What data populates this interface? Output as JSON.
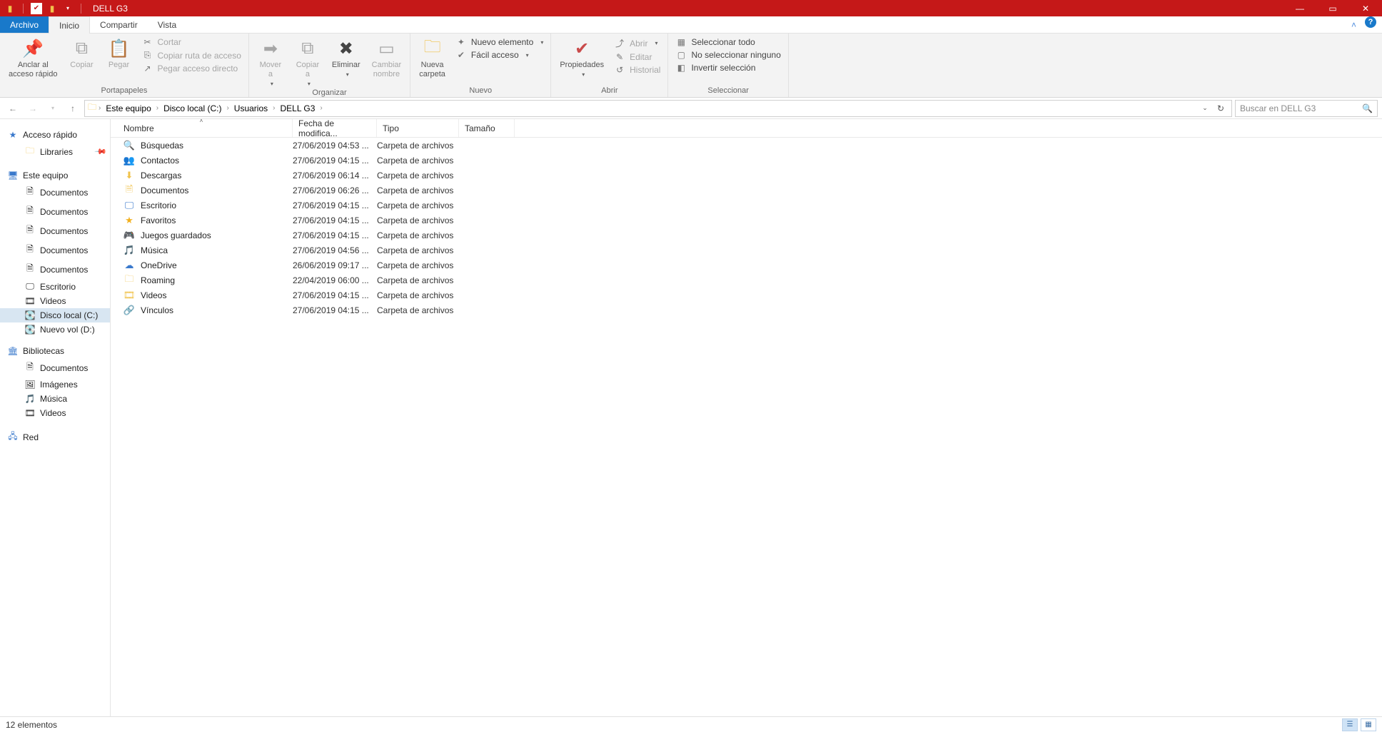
{
  "window": {
    "title": "DELL G3"
  },
  "menu": {
    "file": "Archivo",
    "tabs": [
      "Inicio",
      "Compartir",
      "Vista"
    ],
    "active_index": 0
  },
  "ribbon": {
    "groups": {
      "clipboard": {
        "label": "Portapapeles",
        "pin": "Anclar al\nacceso rápido",
        "copy": "Copiar",
        "paste": "Pegar",
        "cut": "Cortar",
        "copy_path": "Copiar ruta de acceso",
        "paste_shortcut": "Pegar acceso directo"
      },
      "organize": {
        "label": "Organizar",
        "move": "Mover\na",
        "copy_to": "Copiar\na",
        "delete": "Eliminar",
        "rename": "Cambiar\nnombre"
      },
      "new": {
        "label": "Nuevo",
        "new_folder": "Nueva\ncarpeta",
        "new_item": "Nuevo elemento",
        "easy_access": "Fácil acceso"
      },
      "open": {
        "label": "Abrir",
        "properties": "Propiedades",
        "open": "Abrir",
        "edit": "Editar",
        "history": "Historial"
      },
      "select": {
        "label": "Seleccionar",
        "select_all": "Seleccionar todo",
        "select_none": "No seleccionar ninguno",
        "invert": "Invertir selección"
      }
    }
  },
  "breadcrumb": [
    "Este equipo",
    "Disco local (C:)",
    "Usuarios",
    "DELL G3"
  ],
  "search": {
    "placeholder": "Buscar en DELL G3"
  },
  "tree": {
    "quick_access": "Acceso rápido",
    "libraries": "Libraries",
    "this_pc": "Este equipo",
    "this_pc_children": [
      "Documentos",
      "Documentos",
      "Documentos",
      "Documentos",
      "Documentos",
      "Escritorio",
      "Videos",
      "Disco local (C:)",
      "Nuevo vol (D:)"
    ],
    "libraries_root": "Bibliotecas",
    "libraries_children": [
      "Documentos",
      "Imágenes",
      "Música",
      "Videos"
    ],
    "network": "Red"
  },
  "columns": {
    "name": "Nombre",
    "date": "Fecha de modifica...",
    "type": "Tipo",
    "size": "Tamaño"
  },
  "rows": [
    {
      "icon": "search",
      "name": "Búsquedas",
      "date": "27/06/2019 04:53 ...",
      "type": "Carpeta de archivos"
    },
    {
      "icon": "contacts",
      "name": "Contactos",
      "date": "27/06/2019 04:15 ...",
      "type": "Carpeta de archivos"
    },
    {
      "icon": "downloads",
      "name": "Descargas",
      "date": "27/06/2019 06:14 ...",
      "type": "Carpeta de archivos"
    },
    {
      "icon": "docs",
      "name": "Documentos",
      "date": "27/06/2019 06:26 ...",
      "type": "Carpeta de archivos"
    },
    {
      "icon": "desktop",
      "name": "Escritorio",
      "date": "27/06/2019 04:15 ...",
      "type": "Carpeta de archivos"
    },
    {
      "icon": "fav",
      "name": "Favoritos",
      "date": "27/06/2019 04:15 ...",
      "type": "Carpeta de archivos"
    },
    {
      "icon": "games",
      "name": "Juegos guardados",
      "date": "27/06/2019 04:15 ...",
      "type": "Carpeta de archivos"
    },
    {
      "icon": "music",
      "name": "Música",
      "date": "27/06/2019 04:56 ...",
      "type": "Carpeta de archivos"
    },
    {
      "icon": "onedrive",
      "name": "OneDrive",
      "date": "26/06/2019 09:17 ...",
      "type": "Carpeta de archivos"
    },
    {
      "icon": "folder",
      "name": "Roaming",
      "date": "22/04/2019 06:00 ...",
      "type": "Carpeta de archivos"
    },
    {
      "icon": "videos",
      "name": "Videos",
      "date": "27/06/2019 04:15 ...",
      "type": "Carpeta de archivos"
    },
    {
      "icon": "links",
      "name": "Vínculos",
      "date": "27/06/2019 04:15 ...",
      "type": "Carpeta de archivos"
    }
  ],
  "status": {
    "count": "12 elementos"
  }
}
